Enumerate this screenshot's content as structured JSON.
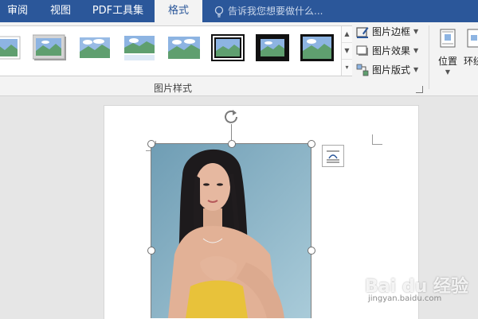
{
  "tabs": [
    {
      "label": "审阅",
      "active": false
    },
    {
      "label": "视图",
      "active": false
    },
    {
      "label": "PDF工具集",
      "active": false
    },
    {
      "label": "格式",
      "active": true
    }
  ],
  "tell_me": {
    "placeholder": "告诉我您想要做什么..."
  },
  "picture_styles": {
    "group_label": "图片样式",
    "thumb_count": 8
  },
  "picture_commands": [
    {
      "label": "图片边框",
      "icon": "picture-border-icon"
    },
    {
      "label": "图片效果",
      "icon": "picture-effects-icon"
    },
    {
      "label": "图片版式",
      "icon": "picture-layout-icon"
    }
  ],
  "arrange": {
    "position_label": "位置",
    "wrap_label": "环绕"
  },
  "watermark": {
    "brand": "Bai du 经验",
    "sub": "jingyan.baidu.com"
  },
  "colors": {
    "tab_bar": "#2b579a",
    "ribbon": "#f3f3f3",
    "workspace": "#e6e6e6"
  }
}
